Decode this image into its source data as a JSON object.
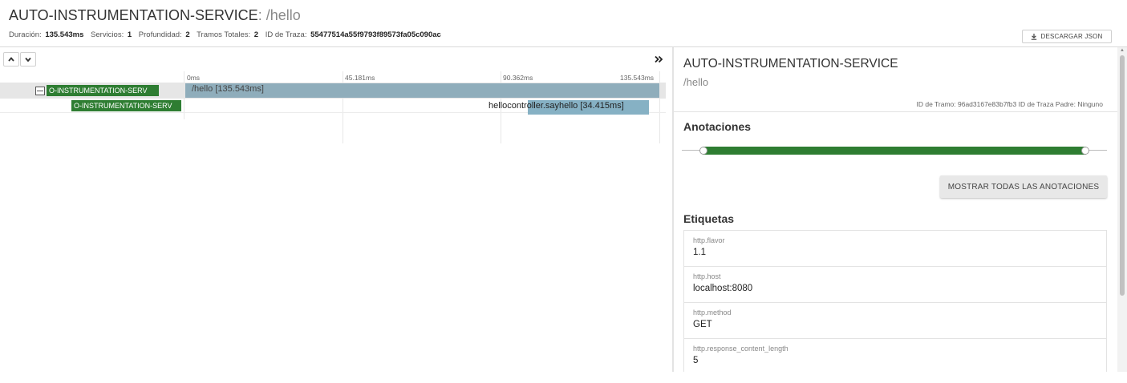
{
  "header": {
    "service": "AUTO-INSTRUMENTATION-SERVICE",
    "route": ": /hello",
    "meta": {
      "duration_label": "Duración:",
      "duration_value": "135.543ms",
      "services_label": "Servicios:",
      "services_value": "1",
      "depth_label": "Profundidad:",
      "depth_value": "2",
      "spans_label": "Tramos Totales:",
      "spans_value": "2",
      "trace_label": "ID de Traza:",
      "trace_value": "55477514a55f9793f89573fa05c090ac"
    },
    "download_label": "DESCARGAR JSON"
  },
  "timeline": {
    "ticks": [
      "0ms",
      "45.181ms",
      "90.362ms",
      "135.543ms"
    ],
    "rows": [
      {
        "service_tag": "O-INSTRUMENTATION-SERV",
        "span_label": "/hello [135.543ms]"
      },
      {
        "service_tag": "O-INSTRUMENTATION-SERV",
        "span_label": "hellocontroller.sayhello [34.415ms]"
      }
    ]
  },
  "detail": {
    "service": "AUTO-INSTRUMENTATION-SERVICE",
    "route": "/hello",
    "ids": "ID de Tramo: 96ad3167e83b7fb3  ID de Traza Padre: Ninguno",
    "annotations_title": "Anotaciones",
    "show_all_label": "MOSTRAR TODAS LAS ANOTACIONES",
    "tags_title": "Etiquetas",
    "tags": [
      {
        "key": "http.flavor",
        "value": "1.1"
      },
      {
        "key": "http.host",
        "value": "localhost:8080"
      },
      {
        "key": "http.method",
        "value": "GET"
      },
      {
        "key": "http.response_content_length",
        "value": "5"
      }
    ]
  },
  "colors": {
    "service_green": "#2e7d32",
    "span_bar_root": "#8fadbb",
    "span_bar_child": "#86b1c4"
  }
}
